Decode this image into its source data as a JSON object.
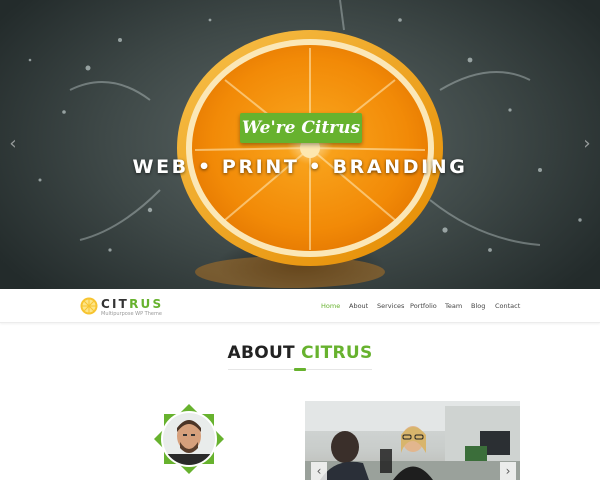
{
  "hero": {
    "tagline": "We're Citrus",
    "headline": "WEB • PRINT • BRANDING",
    "prev_icon": "chevron-left-icon",
    "next_icon": "chevron-right-icon"
  },
  "brand": {
    "name_part1": "CIT",
    "name_part2": "RUS",
    "subtitle": "Multipurpose WP Theme",
    "logo_icon": "citrus-slice-icon"
  },
  "nav": {
    "items": [
      "Home",
      "About",
      "Services",
      "Portfolio",
      "Team",
      "Blog",
      "Contact"
    ],
    "active": "Home"
  },
  "about": {
    "title_part1": "ABOUT",
    "title_part2": "CITRUS"
  },
  "photo_slider": {
    "prev_icon": "chevron-left-icon",
    "next_icon": "chevron-right-icon"
  },
  "colors": {
    "accent": "#67b22e",
    "text_dark": "#222222",
    "nav_text": "#444444"
  }
}
